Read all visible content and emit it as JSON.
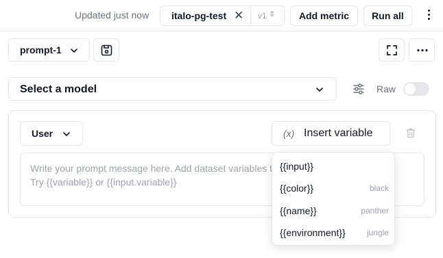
{
  "header": {
    "updated_text": "Updated just now",
    "dataset_name": "italo-pg-test",
    "version_label": "v1",
    "add_metric_label": "Add metric",
    "run_all_label": "Run all"
  },
  "prompt": {
    "name": "prompt-1"
  },
  "model": {
    "placeholder": "Select a model",
    "raw_label": "Raw",
    "raw_enabled": false
  },
  "message": {
    "role": "User",
    "insert_variable_label": "Insert variable",
    "fx_glyph": "(x)",
    "placeholder_line1": "Write your prompt message here. Add dataset variables to it. We suggest.",
    "placeholder_line2": "Try {{variable}} or {{input.variable}}"
  },
  "variables": [
    {
      "name": "{{input}}",
      "value": ""
    },
    {
      "name": "{{color}}",
      "value": "black"
    },
    {
      "name": "{{name}}",
      "value": "panther"
    },
    {
      "name": "{{environment}}",
      "value": "jungle"
    }
  ],
  "icons": [
    "close-icon",
    "chevron-down-icon",
    "save-icon",
    "expand-icon",
    "more-icon",
    "settings-sliders-icon",
    "trash-icon",
    "variable-icon"
  ]
}
